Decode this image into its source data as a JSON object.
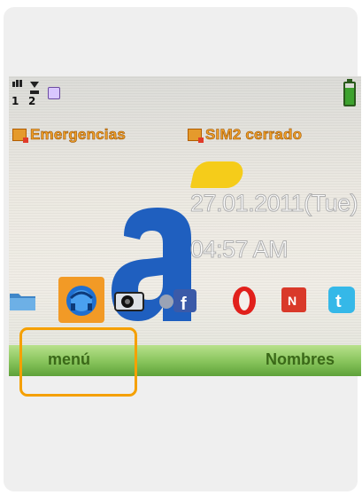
{
  "status": {
    "sim1_label": "Emergencias",
    "sim2_label": "SIM2 cerrado"
  },
  "clock": {
    "date": "27.01.2011(Tue)",
    "time": "04:57 AM"
  },
  "apps": [
    {
      "name": "folder-icon"
    },
    {
      "name": "browser-icon"
    },
    {
      "name": "camera-icon"
    },
    {
      "name": "facebook-icon"
    },
    {
      "name": "opera-icon"
    },
    {
      "name": "news-icon"
    },
    {
      "name": "twitter-icon"
    }
  ],
  "softkeys": {
    "left": "menú",
    "right": "Nombres"
  },
  "colors": {
    "accent": "#f5a000",
    "softbar": "#86c35a",
    "sim_text": "#f0a02a",
    "logo_blue": "#1f5fbf",
    "logo_yellow": "#f5cc1a"
  }
}
